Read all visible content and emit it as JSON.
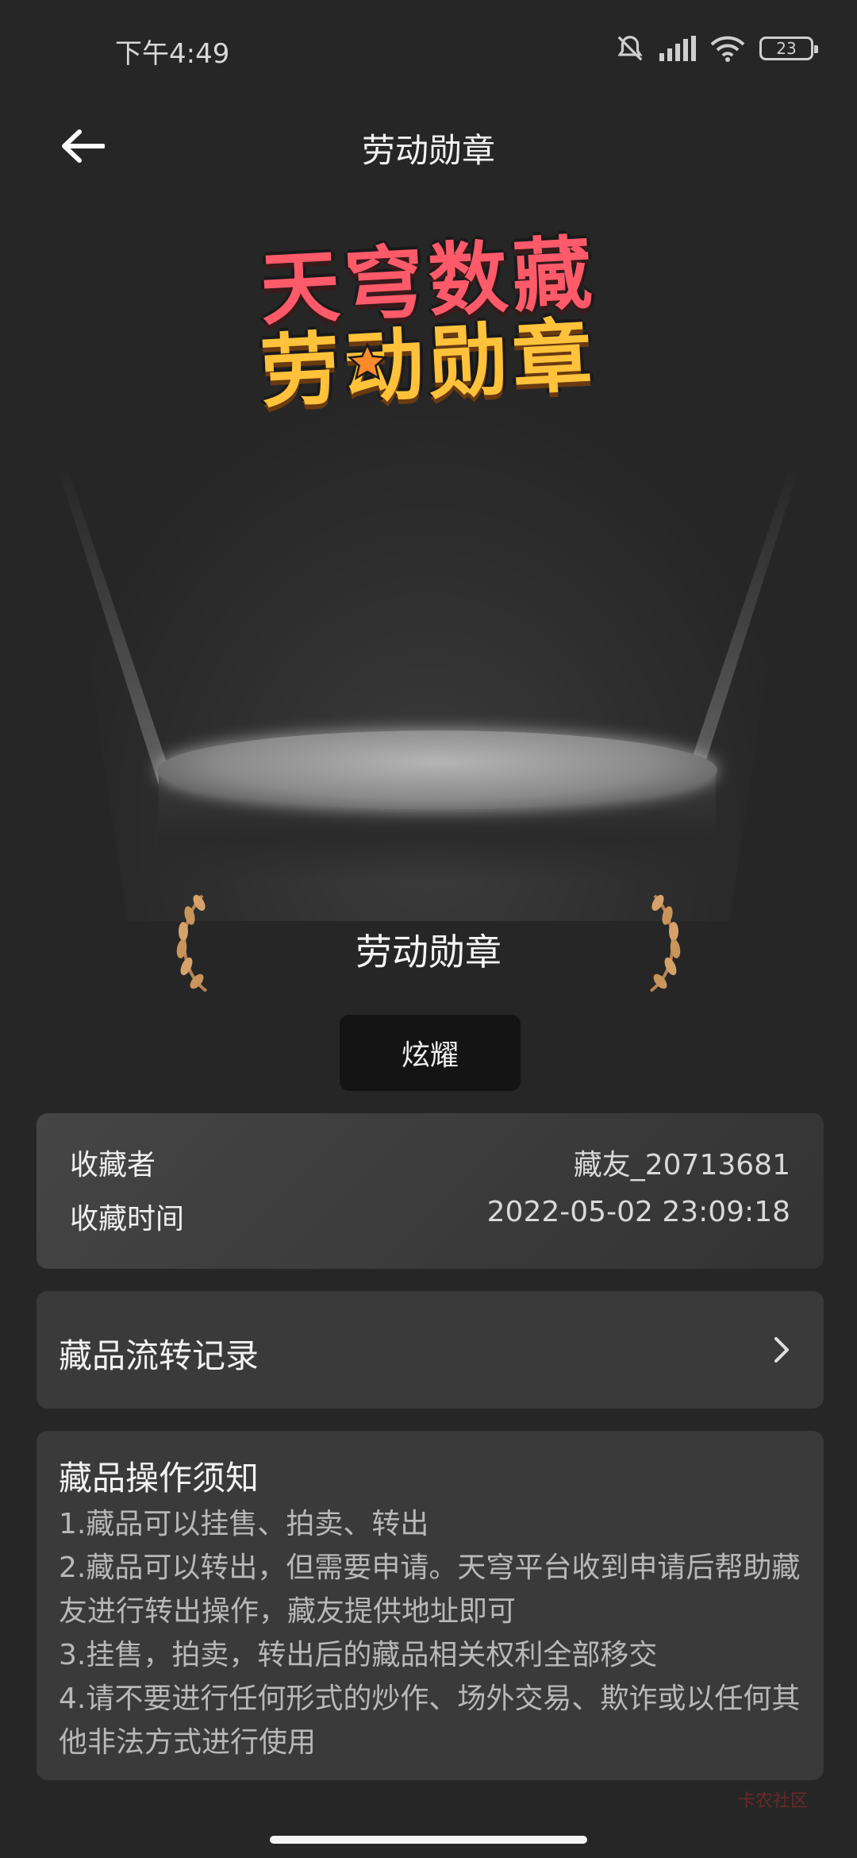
{
  "status_bar": {
    "time": "下午4:49",
    "battery": "23"
  },
  "header": {
    "title": "劳动勋章"
  },
  "hero": {
    "logo_line_1": "天穹数藏",
    "logo_line_2": "劳动勋章"
  },
  "medal": {
    "name": "劳动勋章",
    "show_button": "炫耀"
  },
  "owner_card": {
    "collector_label": "收藏者",
    "collector_value": "藏友_20713681",
    "time_label": "收藏时间",
    "time_value": "2022-05-02 23:09:18"
  },
  "transfer_record": {
    "label": "藏品流转记录"
  },
  "notice": {
    "title": "藏品操作须知",
    "items": [
      "1.藏品可以挂售、拍卖、转出",
      "2.藏品可以转出，但需要申请。天穹平台收到申请后帮助藏友进行转出操作，藏友提供地址即可",
      "3.挂售，拍卖，转出后的藏品相关权利全部移交",
      "4.请不要进行任何形式的炒作、场外交易、欺诈或以任何其他非法方式进行使用"
    ]
  },
  "watermark": "卡农社区",
  "colors": {
    "background": "#262626",
    "card": "#3a3a3a",
    "logo_red": "#ff5a6a",
    "logo_gold": "#ffc23a",
    "laurel_gold": "#c9955a"
  }
}
